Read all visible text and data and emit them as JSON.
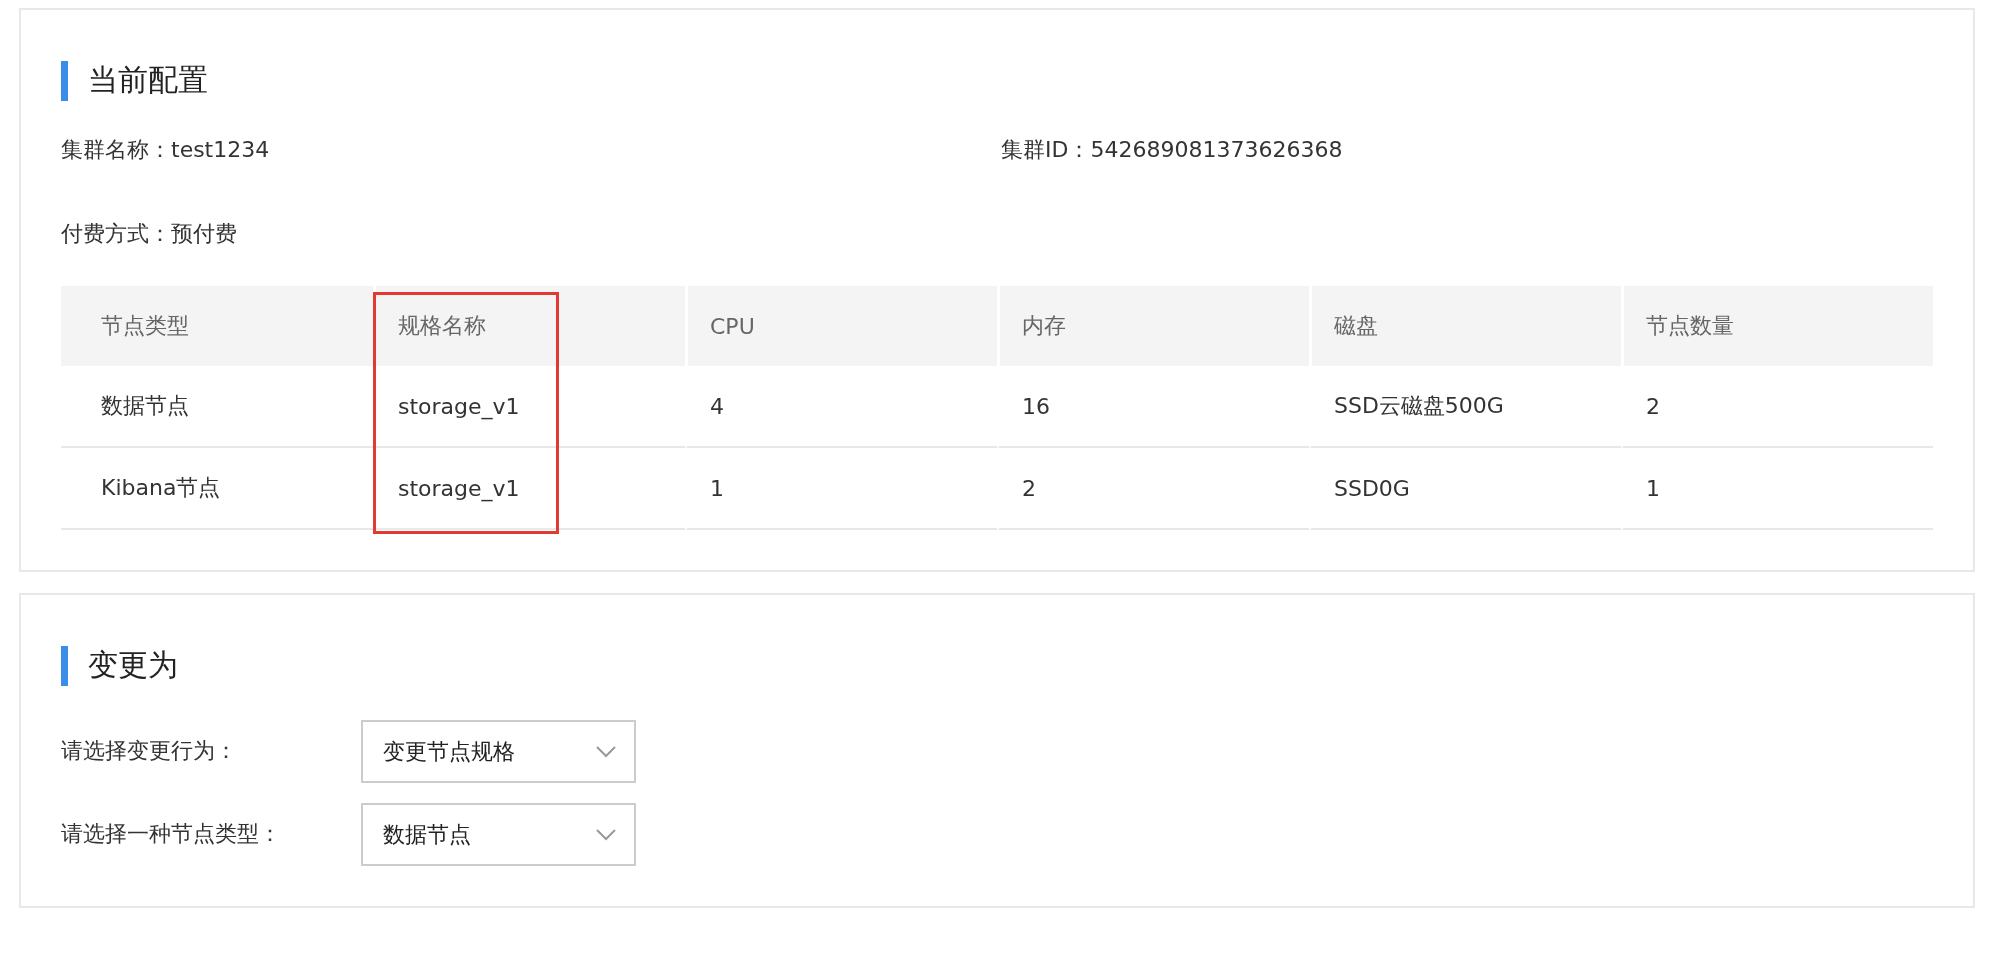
{
  "current_config": {
    "title": "当前配置",
    "fields": [
      {
        "text": "集群名称：test1234"
      },
      {
        "text": "集群ID：542689081373626368"
      },
      {
        "text": "付费方式：预付费"
      }
    ],
    "table": {
      "columns": [
        {
          "label": "节点类型",
          "highlighted": false
        },
        {
          "label": "规格名称",
          "highlighted": true
        },
        {
          "label": "CPU",
          "highlighted": false
        },
        {
          "label": "内存",
          "highlighted": false
        },
        {
          "label": "磁盘",
          "highlighted": false
        },
        {
          "label": "节点数量",
          "highlighted": false
        }
      ],
      "rows": [
        [
          "数据节点",
          "storage_v1",
          "4",
          "16",
          "SSD云磁盘500G",
          "2"
        ],
        [
          "Kibana节点",
          "storage_v1",
          "1",
          "2",
          "SSD0G",
          "1"
        ]
      ]
    }
  },
  "change_to": {
    "title": "变更为",
    "fields": [
      {
        "label": "请选择变更行为：",
        "value": "变更节点规格"
      },
      {
        "label": "请选择一种节点类型：",
        "value": "数据节点"
      }
    ]
  }
}
